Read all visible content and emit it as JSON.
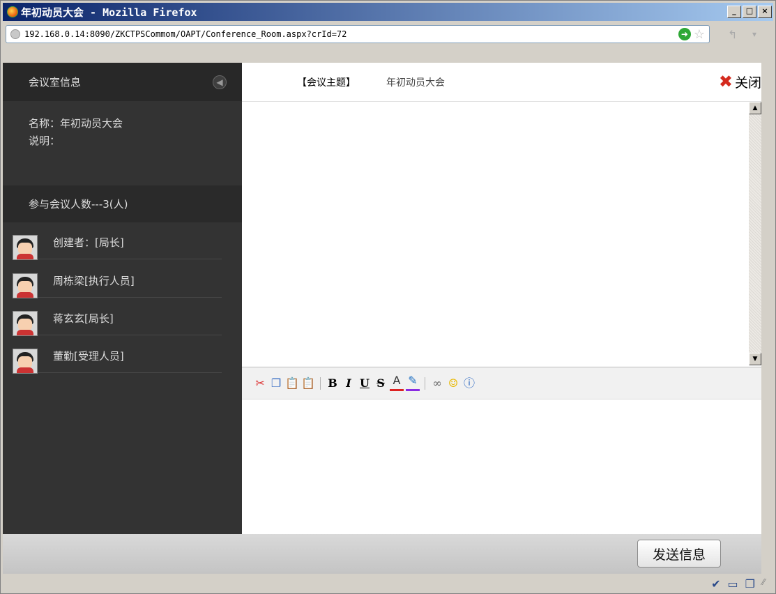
{
  "window": {
    "title": "年初动员大会 - Mozilla Firefox",
    "buttons": {
      "minimize": "_",
      "maximize": "□",
      "close": "×"
    }
  },
  "address": {
    "url": "192.168.0.14:8090/ZKCTPSCommom/OAPT/Conference_Room.aspx?crId=72"
  },
  "sidebar": {
    "header": "会议室信息",
    "name_line": "名称：年初动员大会",
    "desc_line": "说明：",
    "participants": "参与会议人数---3(人)",
    "members": [
      {
        "label": "创建者：[局长]"
      },
      {
        "label": "周栋梁[执行人员]"
      },
      {
        "label": "蒋玄玄[局长]"
      },
      {
        "label": "董勤[受理人员]"
      }
    ]
  },
  "topic": {
    "label": "【会议主题】",
    "value": "年初动员大会",
    "close_label": "关闭"
  },
  "toolbar": {
    "bold": "B",
    "italic": "I",
    "underline": "U",
    "strike": "S",
    "font_color": "A"
  },
  "footer": {
    "send_label": "发送信息"
  },
  "colors": {
    "sidebar_bg": "#333333",
    "close_red": "#d42a1e"
  }
}
